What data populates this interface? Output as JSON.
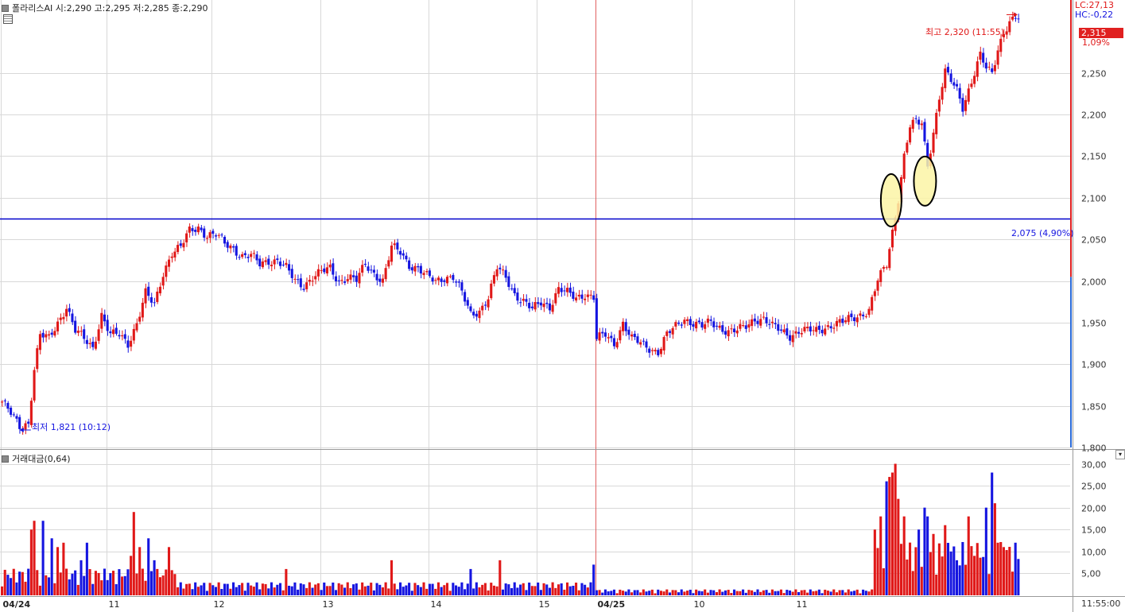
{
  "header": {
    "price_title": "폴라리스AI 시:2,290 고:2,295 저:2,285 종:2,290",
    "volume_title": "거래대금(0,64)"
  },
  "right_panel": {
    "lc": "LC:27,13",
    "hc": "HC:-0,22",
    "last_price": "2,315",
    "last_change": "1,09%",
    "time": "11:55:00"
  },
  "annotations": {
    "high": "최고 2,320 (11:55)",
    "low": "최저 1,821 (10:12)",
    "hline": "2,075 (4,90%)"
  },
  "colors": {
    "up": "#e01818",
    "down": "#1515e0",
    "hline": "#0000cc",
    "grid": "#d8d8d8",
    "divider": "#e06060",
    "marker_fill": "#fbf4a6"
  },
  "chart_data": {
    "type": "candlestick",
    "price": {
      "ylim": [
        1800,
        2330
      ],
      "y_ticks": [
        "1,800",
        "1,850",
        "1,900",
        "1,950",
        "2,000",
        "2,050",
        "2,100",
        "2,150",
        "2,200",
        "2,250"
      ],
      "hline_value": 2075,
      "high": {
        "value": 2320,
        "time": "11:55"
      },
      "low": {
        "value": 1821,
        "time": "10:12"
      },
      "close_series": [
        [
          0,
          1855
        ],
        [
          3,
          1840
        ],
        [
          6,
          1825
        ],
        [
          9,
          1830
        ],
        [
          11,
          1895
        ],
        [
          13,
          1935
        ],
        [
          16,
          1930
        ],
        [
          19,
          1950
        ],
        [
          22,
          1970
        ],
        [
          25,
          1940
        ],
        [
          28,
          1930
        ],
        [
          31,
          1920
        ],
        [
          34,
          1960
        ],
        [
          37,
          1935
        ],
        [
          40,
          1935
        ],
        [
          43,
          1925
        ],
        [
          46,
          1950
        ],
        [
          49,
          1985
        ],
        [
          52,
          1970
        ],
        [
          55,
          2010
        ],
        [
          58,
          2035
        ],
        [
          61,
          2040
        ],
        [
          64,
          2060
        ],
        [
          67,
          2065
        ],
        [
          70,
          2055
        ],
        [
          73,
          2055
        ],
        [
          76,
          2045
        ],
        [
          79,
          2040
        ],
        [
          82,
          2030
        ],
        [
          85,
          2030
        ],
        [
          88,
          2020
        ],
        [
          91,
          2025
        ],
        [
          94,
          2025
        ],
        [
          97,
          2015
        ],
        [
          100,
          2000
        ],
        [
          103,
          1995
        ],
        [
          106,
          2005
        ],
        [
          109,
          2010
        ],
        [
          112,
          2015
        ],
        [
          115,
          2000
        ],
        [
          118,
          2005
        ],
        [
          121,
          2000
        ],
        [
          124,
          2020
        ],
        [
          127,
          2010
        ],
        [
          130,
          2000
        ],
        [
          133,
          2040
        ],
        [
          136,
          2035
        ],
        [
          139,
          2020
        ],
        [
          142,
          2015
        ],
        [
          145,
          2005
        ],
        [
          148,
          2000
        ],
        [
          151,
          2005
        ],
        [
          154,
          2005
        ],
        [
          157,
          1985
        ],
        [
          160,
          1960
        ],
        [
          163,
          1965
        ],
        [
          166,
          1980
        ],
        [
          169,
          2015
        ],
        [
          172,
          2005
        ],
        [
          175,
          1985
        ],
        [
          178,
          1975
        ],
        [
          181,
          1965
        ],
        [
          184,
          1975
        ],
        [
          187,
          1970
        ],
        [
          190,
          1990
        ],
        [
          193,
          1985
        ],
        [
          196,
          1980
        ],
        [
          199,
          1985
        ],
        [
          202,
          1980
        ],
        [
          203,
          1930
        ],
        [
          206,
          1935
        ],
        [
          209,
          1925
        ],
        [
          212,
          1950
        ],
        [
          215,
          1930
        ],
        [
          218,
          1925
        ],
        [
          221,
          1920
        ],
        [
          224,
          1915
        ],
        [
          227,
          1935
        ],
        [
          230,
          1945
        ],
        [
          233,
          1955
        ],
        [
          236,
          1950
        ],
        [
          239,
          1945
        ],
        [
          242,
          1950
        ],
        [
          245,
          1945
        ],
        [
          248,
          1940
        ],
        [
          251,
          1940
        ],
        [
          254,
          1945
        ],
        [
          257,
          1955
        ],
        [
          260,
          1955
        ],
        [
          263,
          1945
        ],
        [
          266,
          1940
        ],
        [
          269,
          1935
        ],
        [
          272,
          1940
        ],
        [
          275,
          1940
        ],
        [
          278,
          1940
        ],
        [
          281,
          1945
        ],
        [
          284,
          1948
        ],
        [
          287,
          1950
        ],
        [
          290,
          1955
        ],
        [
          293,
          1960
        ],
        [
          296,
          1965
        ],
        [
          299,
          2000
        ],
        [
          302,
          2020
        ],
        [
          304,
          2060
        ],
        [
          306,
          2100
        ],
        [
          308,
          2150
        ],
        [
          310,
          2185
        ],
        [
          312,
          2190
        ],
        [
          314,
          2190
        ],
        [
          316,
          2140
        ],
        [
          318,
          2180
        ],
        [
          320,
          2220
        ],
        [
          322,
          2250
        ],
        [
          324,
          2240
        ],
        [
          326,
          2230
        ],
        [
          328,
          2210
        ],
        [
          330,
          2230
        ],
        [
          332,
          2250
        ],
        [
          334,
          2270
        ],
        [
          336,
          2255
        ],
        [
          338,
          2250
        ],
        [
          340,
          2280
        ],
        [
          342,
          2300
        ],
        [
          344,
          2310
        ],
        [
          346,
          2315
        ],
        [
          347,
          2315
        ]
      ],
      "volume_spikes": [
        [
          10,
          15
        ],
        [
          11,
          17
        ],
        [
          14,
          17
        ],
        [
          17,
          13
        ],
        [
          19,
          11
        ],
        [
          21,
          12
        ],
        [
          27,
          8
        ],
        [
          29,
          12
        ],
        [
          44,
          9
        ],
        [
          45,
          19
        ],
        [
          47,
          11
        ],
        [
          50,
          13
        ],
        [
          52,
          8
        ],
        [
          57,
          11
        ],
        [
          97,
          6
        ],
        [
          133,
          8
        ],
        [
          160,
          6
        ],
        [
          170,
          8
        ],
        [
          202,
          7
        ],
        [
          298,
          15
        ],
        [
          300,
          18
        ],
        [
          302,
          26
        ],
        [
          303,
          27
        ],
        [
          304,
          28
        ],
        [
          305,
          30
        ],
        [
          306,
          22
        ],
        [
          308,
          18
        ],
        [
          313,
          15
        ],
        [
          315,
          20
        ],
        [
          316,
          18
        ],
        [
          318,
          14
        ],
        [
          322,
          16
        ],
        [
          324,
          10
        ],
        [
          326,
          8
        ],
        [
          330,
          18
        ],
        [
          332,
          9
        ],
        [
          336,
          20
        ],
        [
          338,
          28
        ],
        [
          339,
          21
        ],
        [
          340,
          12
        ],
        [
          342,
          11
        ]
      ]
    },
    "volume": {
      "ylim": [
        0,
        31
      ],
      "y_ticks": [
        "5,00",
        "10,00",
        "15,00",
        "20,00",
        "25,00",
        "30,00"
      ]
    },
    "x_labels": [
      "04/24",
      "11",
      "12",
      "13",
      "14",
      "15",
      "04/25",
      "10",
      "11"
    ]
  }
}
